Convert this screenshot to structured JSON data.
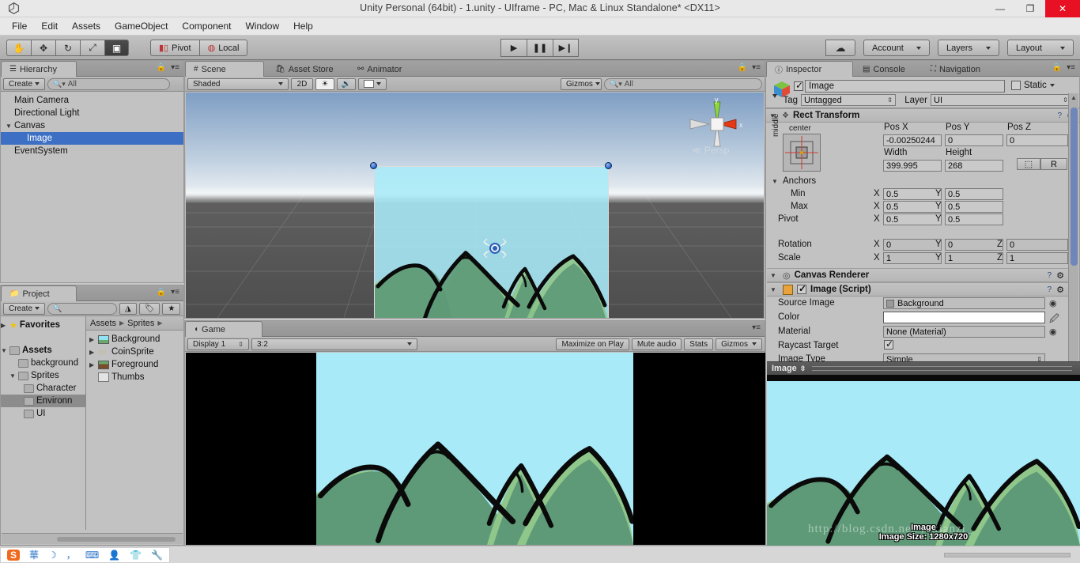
{
  "window": {
    "title": "Unity Personal (64bit) - 1.unity - UIframe - PC, Mac & Linux Standalone* <DX11>",
    "logo": "unity-logo",
    "minimize": "—",
    "maximize": "❐",
    "close": "✕"
  },
  "menubar": {
    "items": [
      "File",
      "Edit",
      "Assets",
      "GameObject",
      "Component",
      "Window",
      "Help"
    ]
  },
  "toolbar": {
    "tools": [
      {
        "name": "hand-tool",
        "glyph": "✋"
      },
      {
        "name": "move-tool",
        "glyph": "✥"
      },
      {
        "name": "rotate-tool",
        "glyph": "↻"
      },
      {
        "name": "scale-tool",
        "glyph": "⤢"
      },
      {
        "name": "rect-tool",
        "glyph": "▣",
        "active": true
      }
    ],
    "pivot_label": "Pivot",
    "local_label": "Local",
    "play": "▶",
    "pause": "❚❚",
    "step": "▶❙",
    "cloud": "☁",
    "account_label": "Account",
    "layers_label": "Layers",
    "layout_label": "Layout"
  },
  "hierarchy": {
    "tab": "Hierarchy",
    "create_label": "Create",
    "search_placeholder": "All",
    "items": [
      {
        "label": "Main Camera",
        "depth": 0,
        "arrow": "",
        "selected": false
      },
      {
        "label": "Directional Light",
        "depth": 0,
        "arrow": "",
        "selected": false
      },
      {
        "label": "Canvas",
        "depth": 0,
        "arrow": "▼",
        "selected": false
      },
      {
        "label": "Image",
        "depth": 1,
        "arrow": "",
        "selected": true
      },
      {
        "label": "EventSystem",
        "depth": 0,
        "arrow": "",
        "selected": false
      }
    ]
  },
  "project": {
    "tab": "Project",
    "create_label": "Create",
    "search_placeholder": "",
    "breadcrumb": [
      "Assets",
      "Sprites"
    ],
    "tree": [
      {
        "label": "Favorites",
        "depth": 0,
        "arrow": "▶",
        "icon": "star",
        "bold": true,
        "selected": false
      },
      {
        "label": "",
        "depth": 0,
        "arrow": "",
        "icon": "none",
        "bold": false,
        "selected": false
      },
      {
        "label": "Assets",
        "depth": 0,
        "arrow": "▼",
        "icon": "folder",
        "bold": true,
        "selected": false
      },
      {
        "label": "background",
        "depth": 1,
        "arrow": "",
        "icon": "folder",
        "bold": false,
        "selected": false
      },
      {
        "label": "Sprites",
        "depth": 1,
        "arrow": "▼",
        "icon": "folder",
        "bold": false,
        "selected": false
      },
      {
        "label": "Character",
        "depth": 2,
        "arrow": "",
        "icon": "folder",
        "bold": false,
        "selected": false
      },
      {
        "label": "Environn",
        "depth": 2,
        "arrow": "",
        "icon": "folder",
        "bold": false,
        "selected": true
      },
      {
        "label": "UI",
        "depth": 2,
        "arrow": "",
        "icon": "folder",
        "bold": false,
        "selected": false
      }
    ],
    "assets": [
      {
        "label": "Background",
        "arrow": "▶",
        "icon": "sprite-landscape"
      },
      {
        "label": "CoinSprite",
        "arrow": "▶",
        "icon": "sprite-coin"
      },
      {
        "label": "Foreground",
        "arrow": "▶",
        "icon": "sprite-foreground"
      },
      {
        "label": "Thumbs",
        "arrow": "",
        "icon": "image-file"
      }
    ]
  },
  "scene": {
    "tabs": [
      {
        "label": "Scene",
        "icon": "grid-icon",
        "active": true
      },
      {
        "label": "Asset Store",
        "icon": "store-icon",
        "active": false
      },
      {
        "label": "Animator",
        "icon": "animator-icon",
        "active": false
      }
    ],
    "shading_mode": "Shaded",
    "mode_2d": "2D",
    "light_icon": "sun-icon",
    "audio_icon": "speaker-icon",
    "fx_icon": "image-icon",
    "gizmos_label": "Gizmos",
    "search_placeholder": "All",
    "axis_gizmo": {
      "y": "y",
      "x": "x",
      "mode": "Persp"
    }
  },
  "game": {
    "tab": "Game",
    "display_label": "Display 1",
    "aspect_label": "3:2",
    "maximize_label": "Maximize on Play",
    "mute_label": "Mute audio",
    "stats_label": "Stats",
    "gizmos_label": "Gizmos"
  },
  "inspector": {
    "tabs": [
      {
        "label": "Inspector",
        "icon": "info-icon",
        "active": true
      },
      {
        "label": "Console",
        "icon": "console-icon",
        "active": false
      },
      {
        "label": "Navigation",
        "icon": "navigation-icon",
        "active": false
      }
    ],
    "object_name": "Image",
    "object_enabled": true,
    "static_label": "Static",
    "static_checked": false,
    "tag_label": "Tag",
    "tag_value": "Untagged",
    "layer_label": "Layer",
    "layer_value": "UI",
    "rect_transform": {
      "title": "Rect Transform",
      "anchor_preset_top": "center",
      "anchor_preset_side": "middle",
      "pos_x_label": "Pos X",
      "pos_x": "-0.00250244",
      "pos_y_label": "Pos Y",
      "pos_y": "0",
      "pos_z_label": "Pos Z",
      "pos_z": "0",
      "width_label": "Width",
      "width": "399.995",
      "height_label": "Height",
      "height": "268",
      "blueprint_btn": "⬚",
      "raw_btn": "R",
      "anchors_label": "Anchors",
      "min_label": "Min",
      "min_x": "0.5",
      "min_y": "0.5",
      "max_label": "Max",
      "max_x": "0.5",
      "max_y": "0.5",
      "pivot_label": "Pivot",
      "pivot_x": "0.5",
      "pivot_y": "0.5",
      "rotation_label": "Rotation",
      "rot_x": "0",
      "rot_y": "0",
      "rot_z": "0",
      "scale_label": "Scale",
      "scale_x": "1",
      "scale_y": "1",
      "scale_z": "1"
    },
    "canvas_renderer": {
      "title": "Canvas Renderer"
    },
    "image_script": {
      "title": "Image (Script)",
      "enabled": true,
      "source_image_label": "Source Image",
      "source_image_value": "Background",
      "color_label": "Color",
      "color_value": "#FFFFFF",
      "material_label": "Material",
      "material_value": "None (Material)",
      "raycast_label": "Raycast Target",
      "raycast_checked": true,
      "image_type_label": "Image Type",
      "image_type_value": "Simple"
    },
    "preview": {
      "title": "Image",
      "name": "Image",
      "size": "Image Size: 1280x720"
    }
  },
  "watermark": "http://blog.csdn.net/yexianzi_",
  "taskbar": {
    "ime_icons": [
      "sogou-logo",
      "chinese-mode",
      "moon-icon",
      "comma-icon",
      "keyboard-icon",
      "user-icon",
      "skin-icon",
      "tools-icon"
    ]
  },
  "colors": {
    "selection_blue": "#3d6fc4",
    "sky": "#a8eaf8",
    "mountain_dark": "#4e8a68",
    "mountain_light": "#8fc78a",
    "close_red": "#e81123"
  }
}
